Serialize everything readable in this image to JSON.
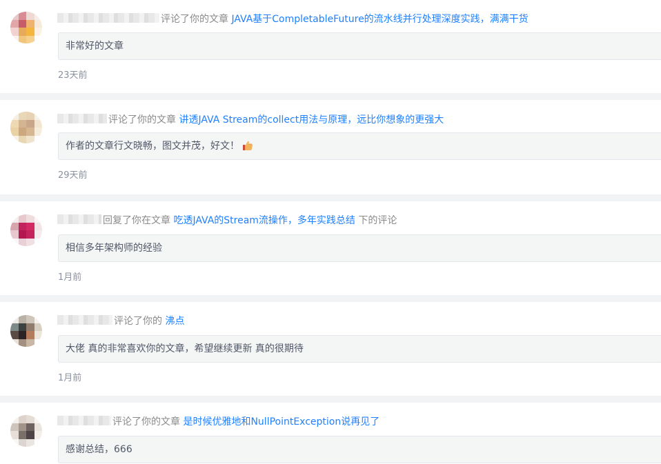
{
  "notifications": [
    {
      "action": "评论了你的文章",
      "link": "JAVA基于CompletableFuture的流水线并行处理深度实践，满满干货",
      "suffix": "",
      "comment": "非常好的文章",
      "time": "23天前",
      "avatar_colors": [
        "#e8c7c9",
        "#d98c93",
        "#f1d9d3",
        "#f7eee8",
        "#e2a6a9",
        "#c65c6a",
        "#f0b36f",
        "#f7ead8",
        "#f2d2ce",
        "#e6aa5b",
        "#f5b63f",
        "#fbf0e2",
        "#fbf2f0",
        "#f1c57b",
        "#f8d08d",
        "#ffffff"
      ]
    },
    {
      "action": "评论了你的文章",
      "link": "讲透JAVA Stream的collect用法与原理，远比你想象的更强大",
      "suffix": "",
      "comment": "作者的文章行文晓畅，图文并茂，好文！",
      "emoji": "thumbs-up",
      "time": "29天前",
      "avatar_colors": [
        "#f5efe0",
        "#e9d8b7",
        "#e8d2b4",
        "#f8f2e6",
        "#eed9b3",
        "#d3b592",
        "#c9a68a",
        "#f2e6d0",
        "#ead2a6",
        "#cda77e",
        "#d7b792",
        "#f5ecdc",
        "#f8f1e6",
        "#e9d7b3",
        "#f0e3cb",
        "#ffffff"
      ]
    },
    {
      "action": "回复了你在文章",
      "link": "吃透JAVA的Stream流操作，多年实践总结",
      "suffix": "下的评论",
      "comment": "相信多年架构师的经验",
      "time": "1月前",
      "avatar_colors": [
        "#f5eded",
        "#e7c8cd",
        "#f0dbde",
        "#faf4f4",
        "#d7a5ae",
        "#c2235c",
        "#d32a63",
        "#f2e3e6",
        "#e9c7cf",
        "#b3174f",
        "#c4235b",
        "#f5eaed",
        "#faf5f6",
        "#e8d0d6",
        "#f1dfe3",
        "#ffffff"
      ]
    },
    {
      "action": "评论了你的",
      "link": "沸点",
      "suffix": "",
      "comment": "大佬 真的非常喜欢你的文章，希望继续更新 真的很期待",
      "time": "1月前",
      "avatar_colors": [
        "#eeeae6",
        "#b9b0a6",
        "#cfc6ba",
        "#f5f1ec",
        "#7d8a88",
        "#3c4240",
        "#8f7c6c",
        "#d8cfc3",
        "#5a4a46",
        "#2b2326",
        "#b47c5b",
        "#ede4da",
        "#e7e1da",
        "#a49080",
        "#c9b7a4",
        "#ffffff"
      ]
    },
    {
      "action": "评论了你的文章",
      "link": "是时候优雅地和NullPointException说再见了",
      "suffix": "",
      "comment": "感谢总结，666",
      "time": "",
      "avatar_colors": [
        "#f2efec",
        "#ddd3cc",
        "#e4dcd5",
        "#f7f4f1",
        "#cfc4bb",
        "#a29489",
        "#6e6361",
        "#ebe4de",
        "#e7ded8",
        "#7b6f6a",
        "#4e4448",
        "#f3eee9",
        "#f9f7f5",
        "#ddd5cf",
        "#ebe5e0",
        "#ffffff"
      ]
    }
  ]
}
